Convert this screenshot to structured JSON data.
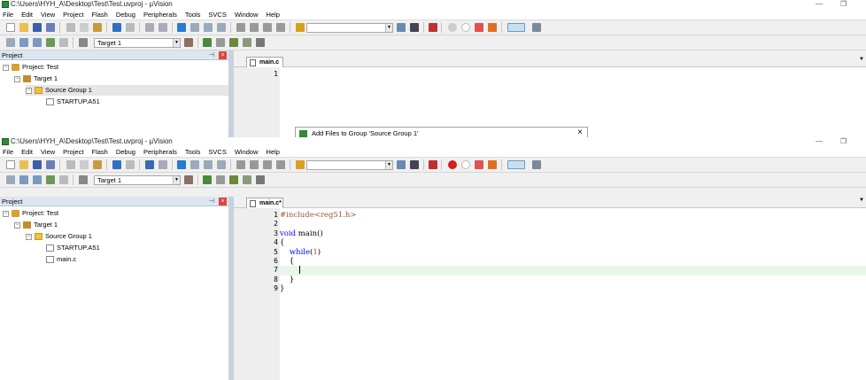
{
  "window1": {
    "title": "C:\\Users\\HYH_A\\Desktop\\Test\\Test.uvproj - µVision",
    "menu": [
      "File",
      "Edit",
      "View",
      "Project",
      "Flash",
      "Debug",
      "Peripherals",
      "Tools",
      "SVCS",
      "Window",
      "Help"
    ],
    "target_combo": "Target 1",
    "panel_title": "Project",
    "tree": [
      {
        "label": "Project: Test",
        "icon": "project-icon"
      },
      {
        "label": "Target 1",
        "icon": "target-icon"
      },
      {
        "label": "Source Group 1",
        "icon": "folder-icon"
      },
      {
        "label": "STARTUP.A51",
        "icon": "file-icon"
      }
    ],
    "tab_label": "main.c",
    "line_numbers": [
      "1"
    ],
    "dialog_title": "Add Files to Group 'Source Group 1'",
    "dialog_close": "×"
  },
  "window2": {
    "title": "C:\\Users\\HYH_A\\Desktop\\Test\\Test.uvproj - µVision",
    "menu": [
      "File",
      "Edit",
      "View",
      "Project",
      "Flash",
      "Debug",
      "Peripherals",
      "Tools",
      "SVCS",
      "Window",
      "Help"
    ],
    "target_combo": "Target 1",
    "panel_title": "Project",
    "tree": [
      {
        "label": "Project: Test",
        "icon": "project-icon"
      },
      {
        "label": "Target 1",
        "icon": "target-icon"
      },
      {
        "label": "Source Group 1",
        "icon": "folder-icon"
      },
      {
        "label": "STARTUP.A51",
        "icon": "file-icon"
      },
      {
        "label": "main.c",
        "icon": "file-icon"
      }
    ],
    "tab_label": "main.c*",
    "line_numbers": [
      "1",
      "2",
      "3",
      "4",
      "5",
      "6",
      "7",
      "8",
      "9"
    ],
    "code": {
      "l1_pp": "#include<reg51.h>",
      "l3_kw": "void",
      "l3_rest": " main()",
      "l4": "{",
      "l5_indent": "    ",
      "l5_kw": "while",
      "l5_open": "(",
      "l5_num": "1",
      "l5_close": ")",
      "l6": "    {",
      "l7_indent": "        ",
      "l8": "    }",
      "l9": "}"
    }
  },
  "window_controls": {
    "minimize": "—",
    "restore": "❐"
  },
  "colors": {
    "keyword": "#0000ff",
    "preprocessor": "#a0522d",
    "current_line": "#e8f8e8",
    "panel_header": "#dde6f0"
  }
}
